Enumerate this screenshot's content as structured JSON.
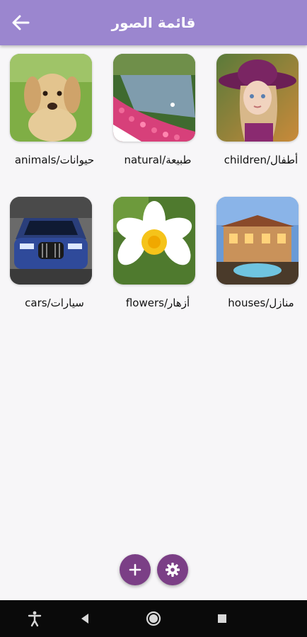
{
  "app_bar": {
    "title": "قائمة الصور",
    "back_icon": "arrow-back-icon",
    "background": "#9b86cf"
  },
  "categories": [
    {
      "label": "children/أطفال",
      "image": "child-in-purple-hat-photo"
    },
    {
      "label": "natural/طبيعة",
      "image": "tulip-garden-pond-photo"
    },
    {
      "label": "animals/حيوانات",
      "image": "labrador-puppy-photo"
    },
    {
      "label": "houses/منازل",
      "image": "villa-with-pool-photo"
    },
    {
      "label": "flowers/أزهار",
      "image": "frangipani-flower-photo"
    },
    {
      "label": "cars/سيارات",
      "image": "blue-bmw-car-photo"
    }
  ],
  "fabs": {
    "add_icon": "plus-icon",
    "settings_icon": "gear-icon",
    "color": "#7b3f86"
  },
  "system_nav": {
    "icons": [
      "accessibility-icon",
      "back-triangle-icon",
      "home-circle-icon",
      "recents-square-icon"
    ]
  }
}
